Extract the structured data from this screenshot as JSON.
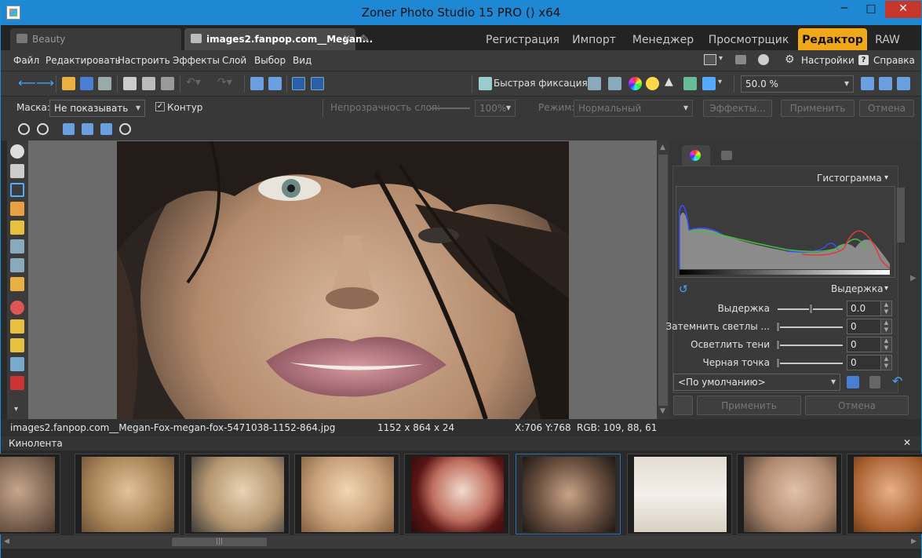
{
  "window": {
    "title": "Zoner Photo Studio 15 PRO  () x64",
    "minimize": "─",
    "maximize": "□",
    "close": "✕"
  },
  "tabs": {
    "documents": [
      {
        "label": "Beauty"
      },
      {
        "label": "images2.fanpop.com__Megan..."
      }
    ],
    "close_glyph": "✕",
    "modes": [
      "Регистрация",
      "Импорт",
      "Менеджер",
      "Просмотрщик",
      "Редактор",
      "RAW"
    ],
    "active_mode": "Редактор"
  },
  "menu": {
    "items": [
      "Файл",
      "Редактировать",
      "Настроить",
      "Эффекты",
      "Слой",
      "Выбор",
      "Вид"
    ],
    "settings": "Настройки",
    "help": "Справка"
  },
  "toolbar": {
    "quick_fix": "Быстрая фиксация...",
    "zoom_value": "50.0 %"
  },
  "options": {
    "mask_label": "Маска:",
    "mask_value": "Не показывать",
    "contour_label": "Контур",
    "contour_checked": true,
    "opacity_label": "Непрозрачность слоя:",
    "opacity_value": "100%",
    "mode_label": "Режим:",
    "mode_value": "Нормальный",
    "effects_btn": "Эффекты...",
    "apply_btn": "Применить",
    "cancel_btn": "Отмена"
  },
  "panel": {
    "histogram_title": "Гистограмма",
    "exposure_title": "Выдержка",
    "sliders": [
      {
        "label": "Выдержка",
        "value": "0.0",
        "level": 0.5
      },
      {
        "label": "Затемнить светлы ...",
        "value": "0",
        "level": 0
      },
      {
        "label": "Осветлить тени",
        "value": "0",
        "level": 0
      },
      {
        "label": "Черная точка",
        "value": "0",
        "level": 0
      }
    ],
    "preset": "<По умолчанию>",
    "apply": "Применить",
    "cancel": "Отмена"
  },
  "status": {
    "filename": "images2.fanpop.com__Megan-Fox-megan-fox-5471038-1152-864.jpg",
    "dimensions": "1152 x 864 x 24",
    "coords": "X:706 Y:768",
    "rgb": "RGB: 109, 88, 61"
  },
  "filmstrip": {
    "title": "Кинолента",
    "close": "✕",
    "selected_index": 5,
    "thumb_count": 9
  },
  "colors": {
    "accent": "#f0a818",
    "titlebar": "#1e88d4",
    "close_red": "#c7362b"
  }
}
